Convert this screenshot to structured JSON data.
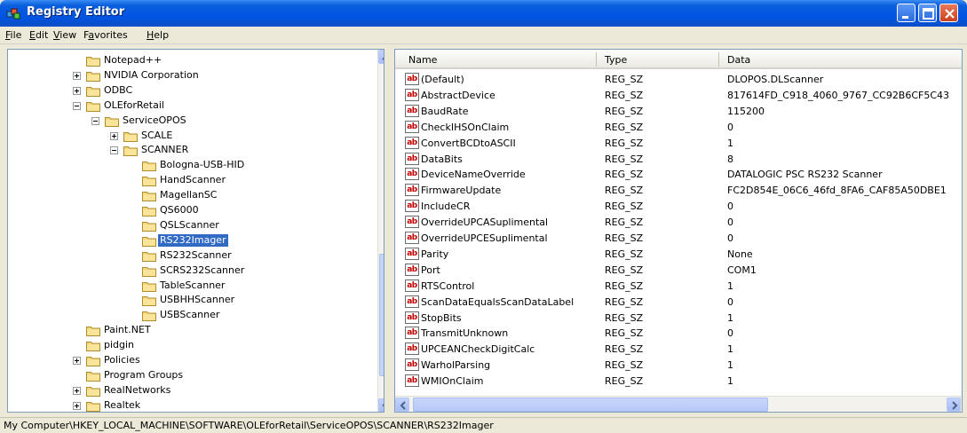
{
  "window": {
    "title": "Registry Editor"
  },
  "menu": [
    {
      "label": "File",
      "u": "F",
      "rest": "ile"
    },
    {
      "label": "Edit",
      "u": "E",
      "rest": "dit"
    },
    {
      "label": "View",
      "u": "V",
      "rest": "iew"
    },
    {
      "label": "Favorites",
      "u": "a",
      "pre": "F",
      "rest": "vorites"
    },
    {
      "label": "Help",
      "u": "H",
      "rest": "elp"
    }
  ],
  "tree": [
    {
      "label": "Notepad++",
      "level": 0,
      "expander": "none"
    },
    {
      "label": "NVIDIA Corporation",
      "level": 0,
      "expander": "plus"
    },
    {
      "label": "ODBC",
      "level": 0,
      "expander": "plus"
    },
    {
      "label": "OLEforRetail",
      "level": 0,
      "expander": "minus"
    },
    {
      "label": "ServiceOPOS",
      "level": 1,
      "expander": "minus"
    },
    {
      "label": "SCALE",
      "level": 2,
      "expander": "plus"
    },
    {
      "label": "SCANNER",
      "level": 2,
      "expander": "minus"
    },
    {
      "label": "Bologna-USB-HID",
      "level": 3,
      "expander": "none"
    },
    {
      "label": "HandScanner",
      "level": 3,
      "expander": "none"
    },
    {
      "label": "MagellanSC",
      "level": 3,
      "expander": "none"
    },
    {
      "label": "QS6000",
      "level": 3,
      "expander": "none"
    },
    {
      "label": "QSLScanner",
      "level": 3,
      "expander": "none"
    },
    {
      "label": "RS232Imager",
      "level": 3,
      "expander": "none",
      "selected": true
    },
    {
      "label": "RS232Scanner",
      "level": 3,
      "expander": "none"
    },
    {
      "label": "SCRS232Scanner",
      "level": 3,
      "expander": "none"
    },
    {
      "label": "TableScanner",
      "level": 3,
      "expander": "none"
    },
    {
      "label": "USBHHScanner",
      "level": 3,
      "expander": "none"
    },
    {
      "label": "USBScanner",
      "level": 3,
      "expander": "none"
    },
    {
      "label": "Paint.NET",
      "level": 0,
      "expander": "none"
    },
    {
      "label": "pidgin",
      "level": 0,
      "expander": "none"
    },
    {
      "label": "Policies",
      "level": 0,
      "expander": "plus"
    },
    {
      "label": "Program Groups",
      "level": 0,
      "expander": "none"
    },
    {
      "label": "RealNetworks",
      "level": 0,
      "expander": "plus"
    },
    {
      "label": "Realtek",
      "level": 0,
      "expander": "plus"
    }
  ],
  "columns": {
    "name": "Name",
    "type": "Type",
    "data": "Data"
  },
  "values": [
    {
      "name": "(Default)",
      "type": "REG_SZ",
      "data": "DLOPOS.DLScanner"
    },
    {
      "name": "AbstractDevice",
      "type": "REG_SZ",
      "data": "817614FD_C918_4060_9767_CC92B6CF5C43"
    },
    {
      "name": "BaudRate",
      "type": "REG_SZ",
      "data": "115200"
    },
    {
      "name": "CheckIHSOnClaim",
      "type": "REG_SZ",
      "data": "0"
    },
    {
      "name": "ConvertBCDtoASCII",
      "type": "REG_SZ",
      "data": "1"
    },
    {
      "name": "DataBits",
      "type": "REG_SZ",
      "data": "8"
    },
    {
      "name": "DeviceNameOverride",
      "type": "REG_SZ",
      "data": "DATALOGIC PSC RS232 Scanner"
    },
    {
      "name": "FirmwareUpdate",
      "type": "REG_SZ",
      "data": "FC2D854E_06C6_46fd_8FA6_CAF85A50DBE1"
    },
    {
      "name": "IncludeCR",
      "type": "REG_SZ",
      "data": "0"
    },
    {
      "name": "OverrideUPCASuplimental",
      "type": "REG_SZ",
      "data": "0"
    },
    {
      "name": "OverrideUPCESuplimental",
      "type": "REG_SZ",
      "data": "0"
    },
    {
      "name": "Parity",
      "type": "REG_SZ",
      "data": "None"
    },
    {
      "name": "Port",
      "type": "REG_SZ",
      "data": "COM1"
    },
    {
      "name": "RTSControl",
      "type": "REG_SZ",
      "data": "1"
    },
    {
      "name": "ScanDataEqualsScanDataLabel",
      "type": "REG_SZ",
      "data": "0"
    },
    {
      "name": "StopBits",
      "type": "REG_SZ",
      "data": "1"
    },
    {
      "name": "TransmitUnknown",
      "type": "REG_SZ",
      "data": "0"
    },
    {
      "name": "UPCEANCheckDigitCalc",
      "type": "REG_SZ",
      "data": "1"
    },
    {
      "name": "WarholParsing",
      "type": "REG_SZ",
      "data": "1"
    },
    {
      "name": "WMIOnClaim",
      "type": "REG_SZ",
      "data": "1"
    }
  ],
  "status": "My Computer\\HKEY_LOCAL_MACHINE\\SOFTWARE\\OLEforRetail\\ServiceOPOS\\SCANNER\\RS232Imager",
  "icons": {
    "app": "registry-icon",
    "folder": "folder-icon",
    "value": "string-value-icon"
  },
  "colors": {
    "titlebar": "#0054e3",
    "selection": "#316ac5",
    "close": "#c9421f"
  }
}
